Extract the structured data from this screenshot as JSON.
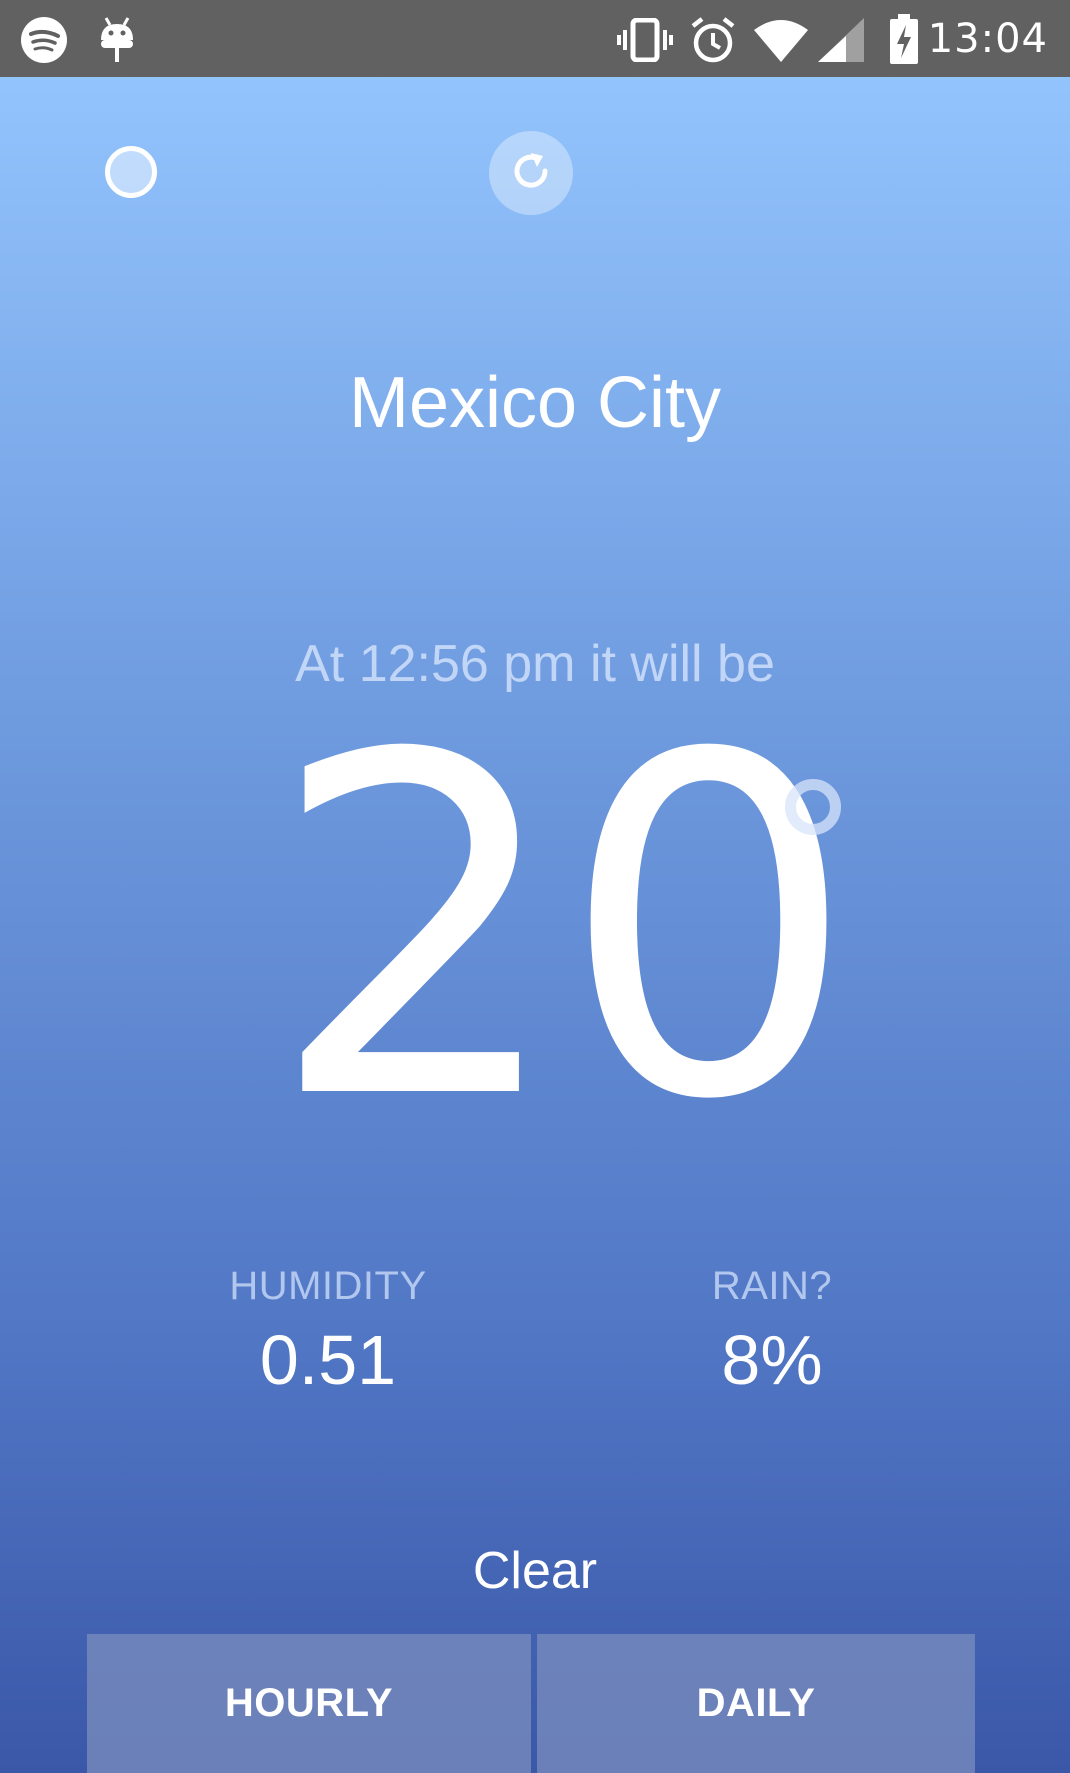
{
  "status_bar": {
    "time": "13:04",
    "left_icons": [
      "spotify-icon",
      "android-debug-icon"
    ],
    "right_icons": [
      "vibrate-icon",
      "alarm-icon",
      "wifi-icon",
      "cell-signal-icon",
      "battery-charging-icon"
    ]
  },
  "toolbar": {
    "left_icon": "circle-icon",
    "refresh_icon": "refresh-icon"
  },
  "location": {
    "city": "Mexico City"
  },
  "forecast": {
    "subtitle": "At 12:56 pm it will be",
    "temperature": "20",
    "humidity_label": "HUMIDITY",
    "humidity_value": "0.51",
    "rain_label": "RAIN?",
    "rain_value": "8%",
    "condition": "Clear"
  },
  "tabs": {
    "hourly_label": "HOURLY",
    "daily_label": "DAILY"
  },
  "colors": {
    "status_bar_bg": "#616161",
    "gradient_top": "#93c4fd",
    "gradient_bottom": "#3b57a8",
    "text": "#ffffff"
  }
}
